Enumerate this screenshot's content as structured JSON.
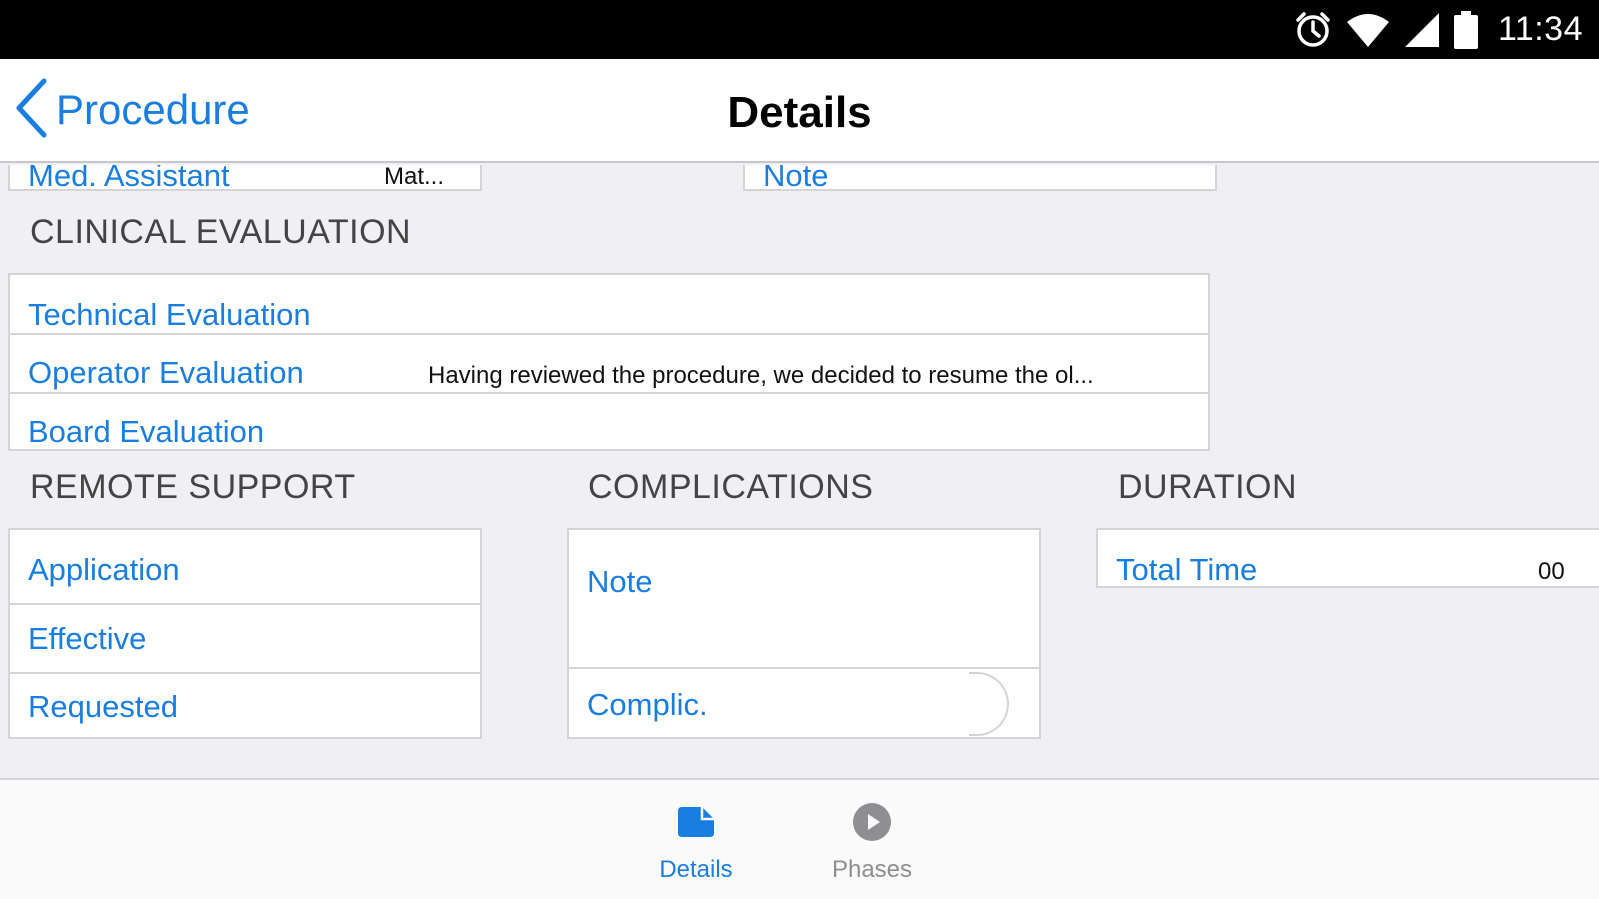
{
  "status_bar": {
    "time": "11:34",
    "icons": [
      "alarm-icon",
      "wifi-icon",
      "signal-icon",
      "battery-icon"
    ]
  },
  "nav": {
    "back_label": "Procedure",
    "title": "Details"
  },
  "top_row": {
    "med_assistant": {
      "label": "Med. Assistant",
      "value": "Mat..."
    },
    "note": {
      "label": "Note"
    }
  },
  "clinical_evaluation": {
    "title": "CLINICAL EVALUATION",
    "rows": [
      {
        "label": "Technical Evaluation",
        "value": ""
      },
      {
        "label": "Operator Evaluation",
        "value": "Having reviewed the procedure, we decided to resume the ol..."
      },
      {
        "label": "Board Evaluation",
        "value": ""
      }
    ]
  },
  "remote_support": {
    "title": "REMOTE SUPPORT",
    "rows": [
      {
        "label": "Application"
      },
      {
        "label": "Effective"
      },
      {
        "label": "Requested"
      }
    ]
  },
  "complications": {
    "title": "COMPLICATIONS",
    "note_label": "Note",
    "complic_label": "Complic."
  },
  "duration": {
    "title": "DURATION",
    "total_time": {
      "label": "Total Time",
      "value": "00"
    }
  },
  "tabs": [
    {
      "label": "Details",
      "icon": "folder-icon",
      "active": true
    },
    {
      "label": "Phases",
      "icon": "play-circle-icon",
      "active": false
    }
  ],
  "colors": {
    "accent": "#1a7ee0",
    "inactive": "#8e8e93",
    "background": "#efeff4"
  }
}
